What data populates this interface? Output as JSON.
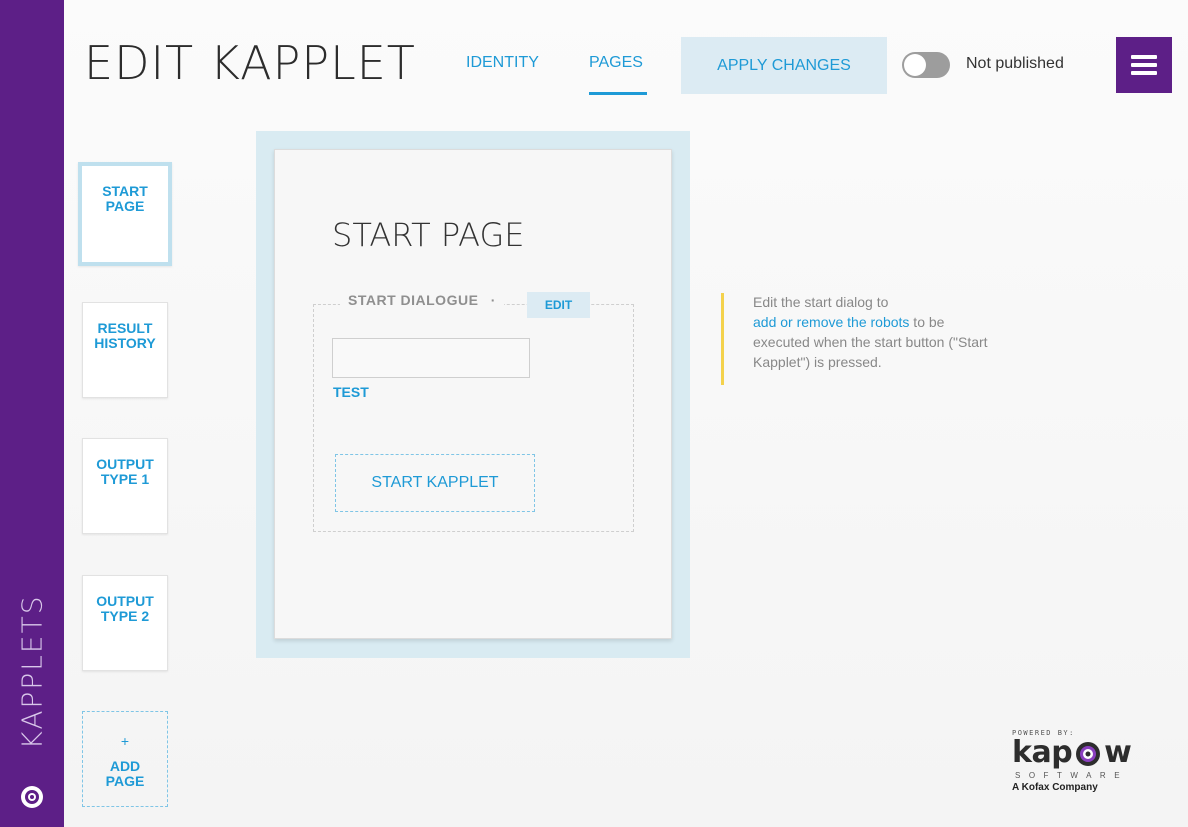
{
  "header": {
    "title": "EDIT KAPPLET",
    "tabs": [
      {
        "label": "IDENTITY",
        "active": false
      },
      {
        "label": "PAGES",
        "active": true
      }
    ],
    "apply_label": "APPLY CHANGES",
    "publish_toggle": {
      "on": false,
      "label": "Not published"
    },
    "menu_icon": "hamburger-icon"
  },
  "sidebar": {
    "label": "KAPPLETS",
    "logo_icon": "kapplets-logo-icon",
    "accent_color": "#5d1f87"
  },
  "pages": {
    "items": [
      {
        "line1": "START",
        "line2": "PAGE",
        "selected": true
      },
      {
        "line1": "RESULT",
        "line2": "HISTORY",
        "selected": false
      },
      {
        "line1": "OUTPUT",
        "line2": "TYPE 1",
        "selected": false
      },
      {
        "line1": "OUTPUT",
        "line2": "TYPE 2",
        "selected": false
      }
    ],
    "add": {
      "plus": "+",
      "line1": "ADD",
      "line2": "PAGE"
    }
  },
  "editor": {
    "page_title": "START PAGE",
    "dialog_label": "START DIALOGUE",
    "dialog_sep": "·",
    "edit_label": "EDIT",
    "input_value": "",
    "input_label": "TEST",
    "start_button": "START KAPPLET"
  },
  "help": {
    "line1": "Edit the start dialog to",
    "link": "add or remove the robots",
    "line2_rest": " to be",
    "line3": "executed when the start button (\"Start",
    "line4": "Kapplet\") is pressed."
  },
  "footer": {
    "powered_by": "POWERED BY:",
    "brand_prefix": "kap",
    "brand_suffix": "w",
    "brand_sub": "SOFTWARE",
    "company": "A Kofax Company"
  },
  "colors": {
    "accent_blue": "#1e9ad6",
    "canvas_blue": "#d9ebf2",
    "help_bar_yellow": "#f4d24c"
  }
}
